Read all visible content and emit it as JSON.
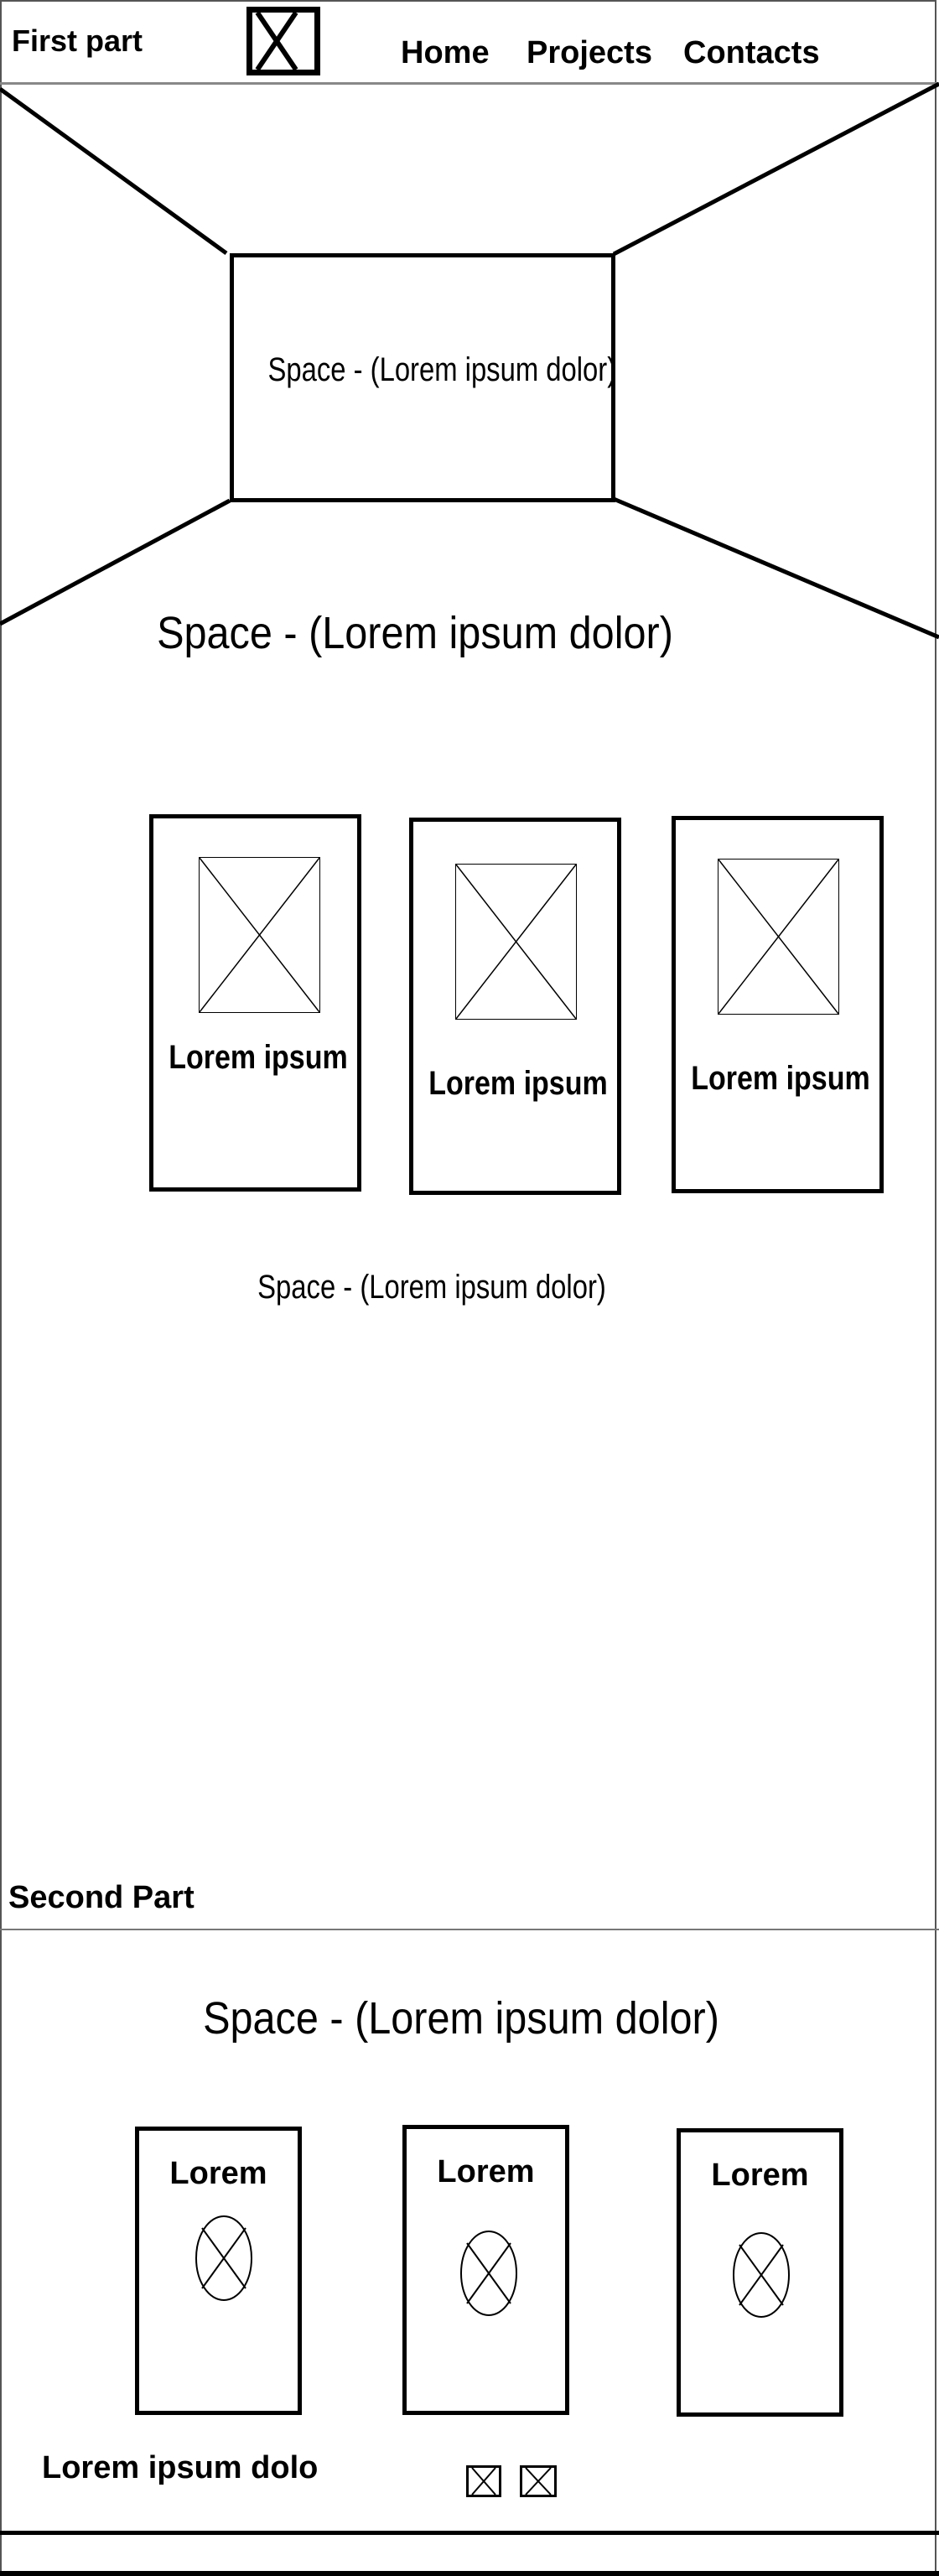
{
  "header": {
    "title": "First part",
    "logo_icon": "image-placeholder-icon",
    "nav": [
      "Home",
      "Projects",
      "Contacts"
    ]
  },
  "hero": {
    "center_text": "Space - (Lorem ipsum dolor)"
  },
  "section1": {
    "heading": "Space - (Lorem ipsum dolor)",
    "cards": [
      {
        "label": "Lorem ipsum"
      },
      {
        "label": "Lorem ipsum"
      },
      {
        "label": "Lorem ipsum"
      }
    ],
    "footer_text": "Space - (Lorem ipsum dolor)"
  },
  "section2": {
    "title": "Second Part",
    "heading": "Space - (Lorem ipsum dolor)",
    "cards": [
      {
        "label": "Lorem"
      },
      {
        "label": "Lorem"
      },
      {
        "label": "Lorem"
      }
    ],
    "footer_text": "Lorem ipsum dolo"
  }
}
